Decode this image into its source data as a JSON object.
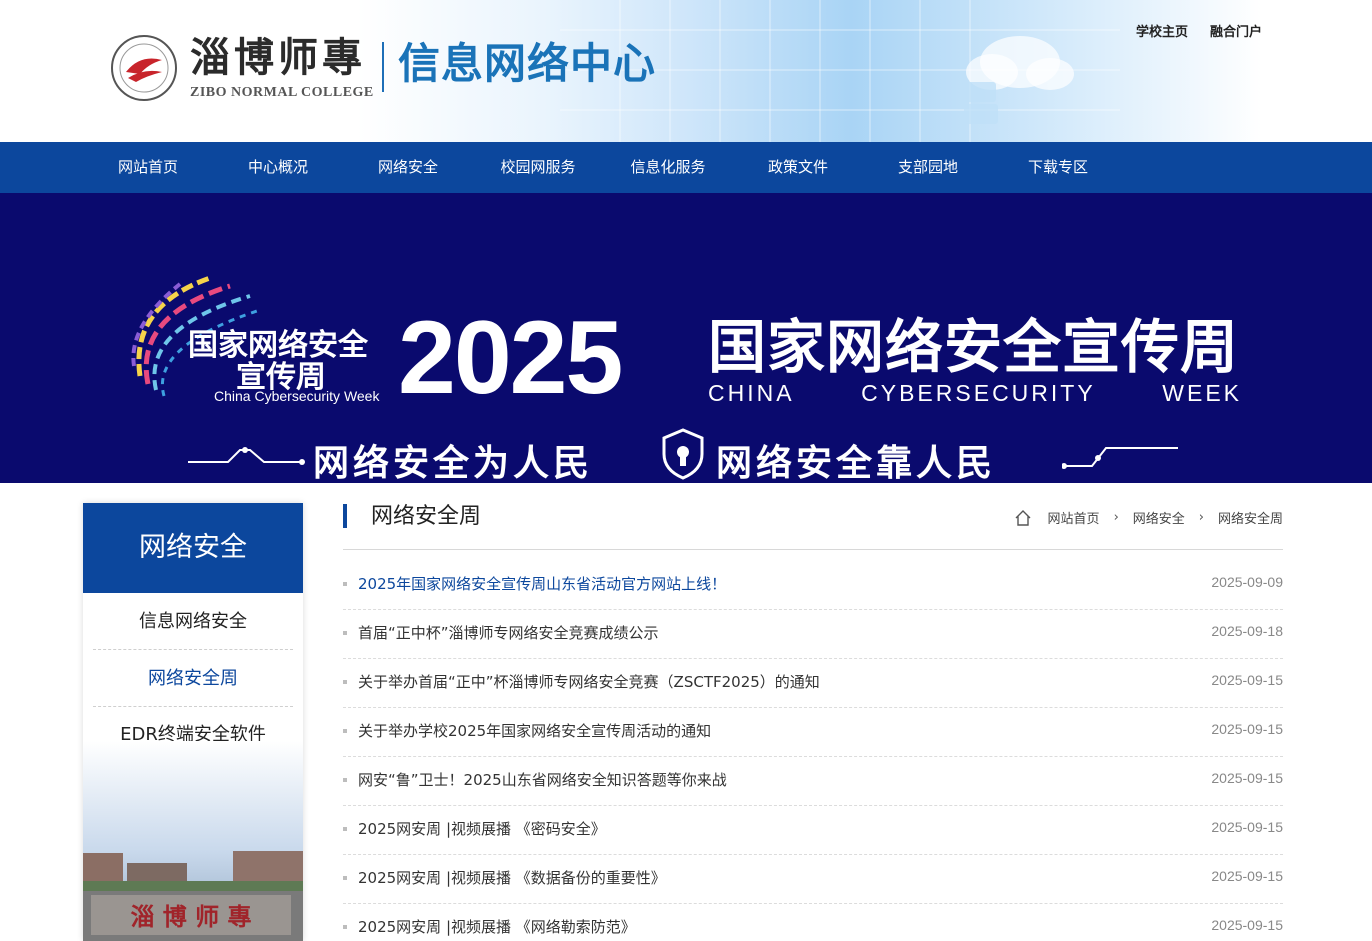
{
  "header": {
    "logo_cn": "淄博师專",
    "logo_en": "ZIBO NORMAL COLLEGE",
    "site_name": "信息网络中心",
    "top_links": [
      "学校主页",
      "融合门户"
    ]
  },
  "nav": {
    "items": [
      "网站首页",
      "中心概况",
      "网络安全",
      "校园网服务",
      "信息化服务",
      "政策文件",
      "支部园地",
      "下载专区"
    ]
  },
  "banner": {
    "left_line1": "国家网络安全",
    "left_line2": "宣传周",
    "left_line3": "China Cybersecurity Week",
    "year": "2025",
    "title": "国家网络安全宣传周",
    "en_words": [
      "CHINA",
      "CYBERSECURITY",
      "WEEK"
    ],
    "slogan_left": "网络安全为人民",
    "slogan_right": "网络安全靠人民"
  },
  "sidebar": {
    "title": "网络安全",
    "items": [
      "信息网络安全",
      "网络安全周",
      "EDR终端安全软件"
    ],
    "active_index": 1,
    "photo_text": "淄 博 师 專"
  },
  "content": {
    "section_title": "网络安全周",
    "breadcrumb": [
      "网站首页",
      "网络安全",
      "网络安全周"
    ],
    "news": [
      {
        "title": "2025年国家网络安全宣传周山东省活动官方网站上线！",
        "date": "2025-09-09"
      },
      {
        "title": "首届“正中杯”淄博师专网络安全竞赛成绩公示",
        "date": "2025-09-18"
      },
      {
        "title": "关于举办首届“正中”杯淄博师专网络安全竞赛（ZSCTF2025）的通知",
        "date": "2025-09-15"
      },
      {
        "title": "关于举办学校2025年国家网络安全宣传周活动的通知",
        "date": "2025-09-15"
      },
      {
        "title": "网安“鲁”卫士！2025山东省网络安全知识答题等你来战",
        "date": "2025-09-15"
      },
      {
        "title": "2025网安周 |视频展播 《密码安全》",
        "date": "2025-09-15"
      },
      {
        "title": "2025网安周 |视频展播 《数据备份的重要性》",
        "date": "2025-09-15"
      },
      {
        "title": "2025网安周 |视频展播 《网络勒索防范》",
        "date": "2025-09-15"
      }
    ]
  },
  "colors": {
    "primary_blue": "#0c479d",
    "banner_bg": "#0a0a6e",
    "site_name_blue": "#1a73b8"
  }
}
